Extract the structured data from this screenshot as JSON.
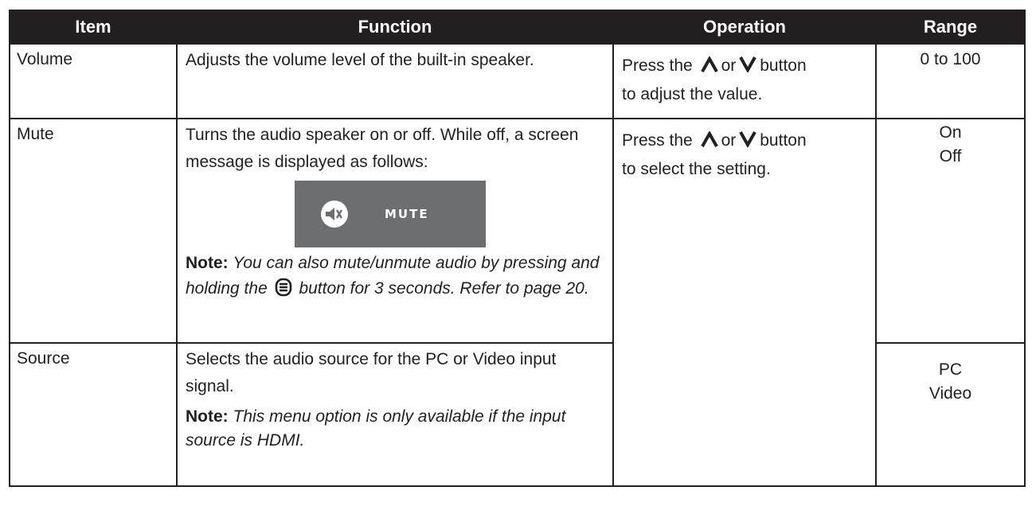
{
  "headers": {
    "item": "Item",
    "function": "Function",
    "operation": "Operation",
    "range": "Range"
  },
  "rows": {
    "volume": {
      "item": "Volume",
      "function": "Adjusts the volume level of the built-in speaker.",
      "operation_before": "Press the",
      "operation_or": "or",
      "operation_after": "button",
      "operation_line2": "to adjust the value.",
      "range": "0 to 100"
    },
    "mute": {
      "item": "Mute",
      "function": "Turns the audio speaker on or off. While off, a screen message is displayed as follows:",
      "osd_text": "MUTE",
      "note_label": "Note:",
      "note_before": "You can also mute/unmute audio by pressing and holding the",
      "note_after": "button for 3 seconds. Refer to page 20.",
      "operation_before": "Press the",
      "operation_or": "or",
      "operation_after": "button",
      "operation_line2": "to select the setting.",
      "range": [
        "On",
        "Off"
      ]
    },
    "source": {
      "item": "Source",
      "function": "Selects the audio source for the PC or Video input signal.",
      "note_label": "Note:",
      "note_text": "This menu option is only available if the input source is HDMI.",
      "range": [
        "PC",
        "Video"
      ]
    }
  },
  "icons": {
    "up": "up-chevron-icon",
    "down": "down-chevron-icon",
    "menu": "menu-button-icon",
    "mute": "speaker-mute-icon"
  },
  "colors": {
    "header_bg": "#231f20",
    "osd_bg": "#6d6e71",
    "text": "#231f20"
  }
}
